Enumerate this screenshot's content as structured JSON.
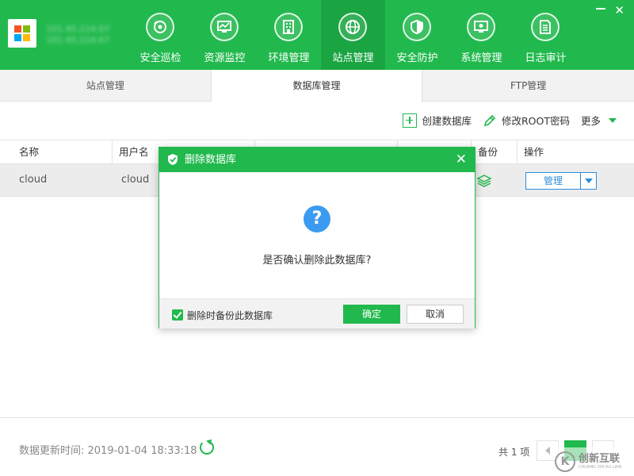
{
  "header": {
    "server_name": "101.45.214.67",
    "server_sub": "101.45.214.67",
    "nav": [
      {
        "label": "安全巡检",
        "icon": "shield-scan-icon"
      },
      {
        "label": "资源监控",
        "icon": "monitor-chart-icon"
      },
      {
        "label": "环境管理",
        "icon": "building-icon"
      },
      {
        "label": "站点管理",
        "icon": "globe-icon"
      },
      {
        "label": "安全防护",
        "icon": "shield-icon"
      },
      {
        "label": "系统管理",
        "icon": "settings-monitor-icon"
      },
      {
        "label": "日志审计",
        "icon": "document-icon"
      }
    ],
    "active_nav": "站点管理"
  },
  "tabs": [
    {
      "label": "站点管理"
    },
    {
      "label": "数据库管理"
    },
    {
      "label": "FTP管理"
    }
  ],
  "active_tab": "数据库管理",
  "toolbar": {
    "create_db": "创建数据库",
    "change_root_pw": "修改ROOT密码",
    "more": "更多"
  },
  "table": {
    "headers": {
      "name": "名称",
      "user": "用户名",
      "backup": "备份",
      "action": "操作"
    },
    "rows": [
      {
        "name": "cloud",
        "user": "cloud",
        "action": "管理"
      }
    ]
  },
  "footer": {
    "updated_label": "数据更新时间: 2019-01-04 18:33:18",
    "total": "共 1 项"
  },
  "modal": {
    "title": "删除数据库",
    "question": "是否确认删除此数据库?",
    "checkbox_label": "删除时备份此数据库",
    "checkbox_checked": true,
    "ok": "确定",
    "cancel": "取消"
  },
  "watermark": {
    "text": "创新互联",
    "sub": "CHUANG XIN HU LIAN"
  },
  "colors": {
    "brand_green": "#21b94d",
    "active_nav": "#1aa542",
    "link_blue": "#2d8ed9",
    "question_blue": "#3b9bf0"
  }
}
